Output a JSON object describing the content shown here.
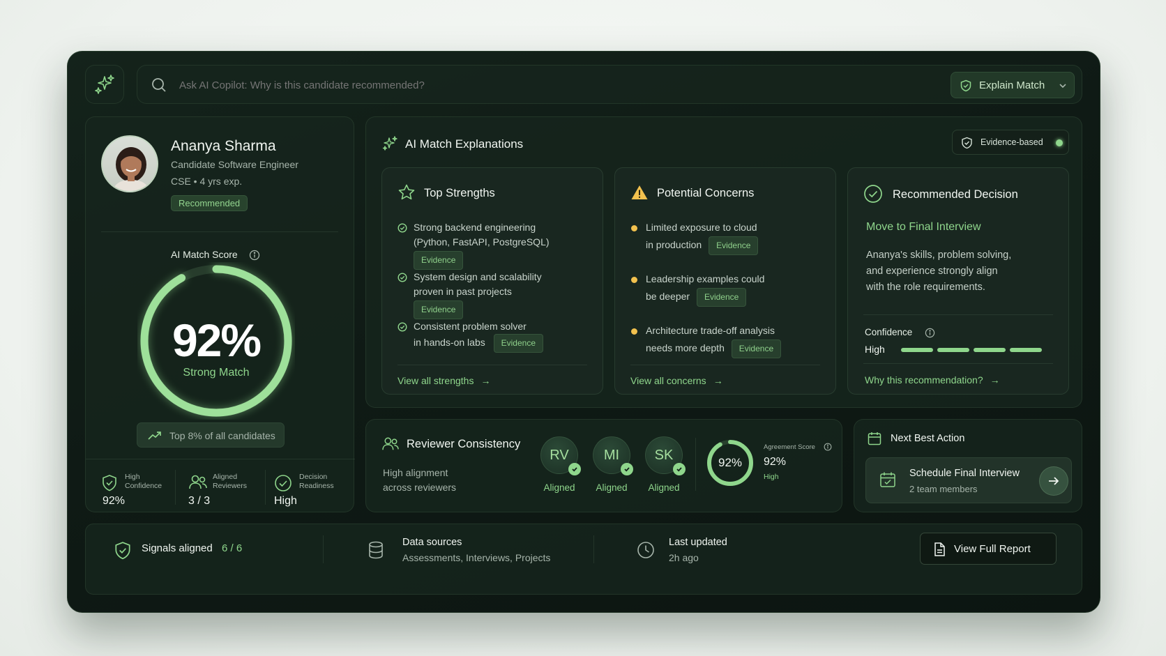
{
  "search": {
    "placeholder": "Ask AI Copilot: Why is this candidate recommended?",
    "mode_label": "Explain Match"
  },
  "candidate": {
    "name": "Ananya Sharma",
    "title": "Candidate Software Engineer",
    "meta": "CSE • 4 yrs exp.",
    "status": "Recommended"
  },
  "score": {
    "label": "AI Match Score",
    "value_text": "92%",
    "value": 92,
    "sub": "Strong Match",
    "rank": "Top 8% of all candidates"
  },
  "stats": [
    {
      "label_line1": "High",
      "label_line2": "Confidence",
      "value": "92%"
    },
    {
      "label_line1": "Aligned",
      "label_line2": "Reviewers",
      "value": "3 / 3"
    },
    {
      "label_line1": "Decision",
      "label_line2": "Readiness",
      "value": "High"
    }
  ],
  "explanations": {
    "title": "AI Match Explanations",
    "badge": "Evidence-based"
  },
  "strengths": {
    "title": "Top Strengths",
    "items": [
      {
        "line1": "Strong backend engineering",
        "line2": "(Python, FastAPI, PostgreSQL)",
        "tag": "Evidence"
      },
      {
        "line1": "System design and scalability",
        "line2": "proven in past projects",
        "tag": "Evidence"
      },
      {
        "line1": "Consistent problem solver",
        "line2": "in hands-on labs",
        "tag": "Evidence"
      }
    ],
    "link": "View all strengths"
  },
  "concerns": {
    "title": "Potential Concerns",
    "items": [
      {
        "line1": "Limited exposure to cloud",
        "line2": "in production",
        "tag": "Evidence"
      },
      {
        "line1": "Leadership examples could",
        "line2": "be deeper",
        "tag": "Evidence"
      },
      {
        "line1": "Architecture trade-off analysis",
        "line2": "needs more depth",
        "tag": "Evidence"
      }
    ],
    "link": "View all concerns"
  },
  "decision": {
    "title": "Recommended Decision",
    "action": "Move to Final Interview",
    "body_line1": "Ananya's skills, problem solving,",
    "body_line2": "and experience strongly align",
    "body_line3": "with the role requirements.",
    "confidence_label": "Confidence",
    "confidence_value": "High",
    "confidence_level": 1.0,
    "link": "Why this recommendation?"
  },
  "reviewers": {
    "title": "Reviewer Consistency",
    "desc_line1": "High alignment",
    "desc_line2": "across reviewers",
    "people": [
      {
        "initials": "RV",
        "status": "Aligned"
      },
      {
        "initials": "MI",
        "status": "Aligned"
      },
      {
        "initials": "SK",
        "status": "Aligned"
      }
    ],
    "agreement_label": "Agreement Score",
    "agreement_ring": "92%",
    "agreement_value": "92%",
    "agreement_value_num": 92,
    "agreement_level": "High"
  },
  "next_action": {
    "title": "Next Best Action",
    "action": "Schedule Final Interview",
    "sub": "2 team members"
  },
  "footer": {
    "signals_label": "Signals aligned",
    "signals_value": "6 / 6",
    "sources_label": "Data sources",
    "sources_value": "Assessments, Interviews, Projects",
    "updated_label": "Last updated",
    "updated_value": "2h ago",
    "report_button": "View Full Report"
  },
  "colors": {
    "accent": "#8fd68c",
    "bg": "#0f1a15",
    "warning": "#f2c14e"
  }
}
